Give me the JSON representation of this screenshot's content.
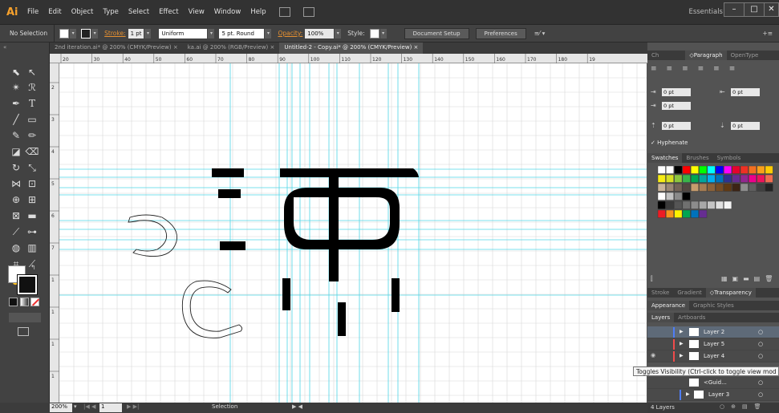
{
  "menu": {
    "logo": "Ai",
    "items": [
      "File",
      "Edit",
      "Object",
      "Type",
      "Select",
      "Effect",
      "View",
      "Window",
      "Help"
    ],
    "workspace": "Essentials",
    "window_buttons": [
      "–",
      "□",
      "✕"
    ]
  },
  "control": {
    "selection": "No Selection",
    "stroke_label": "Stroke:",
    "stroke_value": "1 pt",
    "profile": "Uniform",
    "brush": "5 pt. Round",
    "opacity_label": "Opacity:",
    "opacity_value": "100%",
    "style_label": "Style:",
    "doc_setup": "Document Setup",
    "preferences": "Preferences"
  },
  "tabs": [
    {
      "label": "2nd iteration.ai* @ 200% (CMYK/Preview)",
      "close": "×"
    },
    {
      "label": "ka.ai @ 200% (RGB/Preview)",
      "close": "×"
    },
    {
      "label": "Untitled-2 - Copy.ai* @ 200% (CMYK/Preview)",
      "close": "×"
    }
  ],
  "ruler": {
    "top_labels": [
      "20",
      "30",
      "40",
      "50",
      "60",
      "70",
      "80",
      "90",
      "100",
      "110",
      "120",
      "130",
      "140",
      "150",
      "160",
      "170",
      "180",
      "19"
    ],
    "left_labels": [
      "2",
      "3",
      "4",
      "5",
      "6",
      "7",
      "1",
      "1",
      "1",
      "1"
    ]
  },
  "panels": {
    "character_tabs": [
      "Ch",
      "◇Paragraph",
      "OpenType"
    ],
    "para_fields": [
      "0 pt",
      "0 pt",
      "0 pt",
      "0 pt",
      "0 pt"
    ],
    "hyphenate": "Hyphenate",
    "swatch_tabs": [
      "Swatches",
      "Brushes",
      "Symbols"
    ],
    "stroke_tabs": [
      "Stroke",
      "Gradient",
      "◇Transparency"
    ],
    "appearance_tabs": [
      "Appearance",
      "Graphic Styles"
    ],
    "layer_tabs": [
      "Layers",
      "Artboards"
    ],
    "layers": [
      {
        "name": "Layer 2",
        "color": "#4f7df5"
      },
      {
        "name": "Layer 5",
        "color": "#f04b4b"
      },
      {
        "name": "Layer 4",
        "color": "#f04b4b"
      },
      {
        "name": "<Guid...",
        "color": "#f04b4b"
      },
      {
        "name": "Layer 3",
        "color": "#4f7df5"
      }
    ],
    "layers_count": "4 Layers"
  },
  "status": {
    "zoom": "200%",
    "page": "1",
    "tool": "Selection"
  },
  "tooltip": "Toggles Visibility (Ctrl-click to toggle view mod"
}
